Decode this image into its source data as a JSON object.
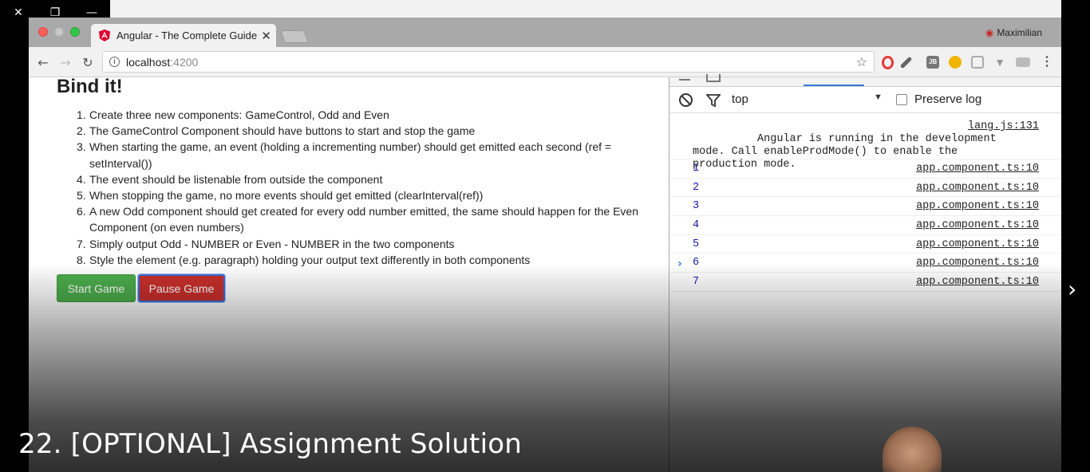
{
  "player": {
    "close_glyph": "✕",
    "restore_glyph": "❐",
    "minimize_glyph": "—",
    "next_glyph": "›",
    "caption": "22. [OPTIONAL] Assignment Solution"
  },
  "browser": {
    "tab_title": "Angular - The Complete Guide",
    "tab_close": "✕",
    "profile_name": "Maximilian",
    "address_host": "localhost",
    "address_port": ":4200",
    "back": "←",
    "forward": "→",
    "reload": "↻",
    "star": "☆",
    "menu": "⋮",
    "jb": "JB",
    "v": "▼"
  },
  "page": {
    "heading": "Bind it!",
    "tasks": [
      {
        "num": "1.",
        "text": "Create three new components: GameControl, Odd and Even"
      },
      {
        "num": "2.",
        "text": "The GameControl Component should have buttons to start and stop the game"
      },
      {
        "num": "3.",
        "text": "When starting the game, an event (holding a incrementing number) should get emitted each second (ref = setInterval())"
      },
      {
        "num": "4.",
        "text": "The event should be listenable from outside the component"
      },
      {
        "num": "5.",
        "text": "When stopping the game, no more events should get emitted (clearInterval(ref))"
      },
      {
        "num": "6.",
        "text": "A new Odd component should get created for every odd number emitted, the same should happen for the Even Component (on even numbers)"
      },
      {
        "num": "7.",
        "text": "Simply output Odd - NUMBER or Even - NUMBER in the two components"
      },
      {
        "num": "8.",
        "text": "Style the element (e.g. paragraph) holding your output text differently in both components"
      }
    ],
    "start_button": "Start Game",
    "pause_button": "Pause Game"
  },
  "devtools": {
    "context": "top",
    "context_arrow": "▼",
    "preserve_log": "Preserve log",
    "warning_text": "Angular is running in the development\nmode. Call enableProdMode() to enable the\nproduction mode.",
    "warning_source": "lang.js:131",
    "logs": [
      {
        "value": "1",
        "source": "app.component.ts:10"
      },
      {
        "value": "2",
        "source": "app.component.ts:10"
      },
      {
        "value": "3",
        "source": "app.component.ts:10"
      },
      {
        "value": "4",
        "source": "app.component.ts:10"
      },
      {
        "value": "5",
        "source": "app.component.ts:10"
      },
      {
        "value": "6",
        "source": "app.component.ts:10"
      },
      {
        "value": "7",
        "source": "app.component.ts:10"
      }
    ],
    "prompt": "›"
  },
  "colors": {
    "start_green": "#4cae4c",
    "pause_red": "#c9302c",
    "log_value_blue": "#1a1aa6",
    "devtools_accent": "#3879d9"
  }
}
